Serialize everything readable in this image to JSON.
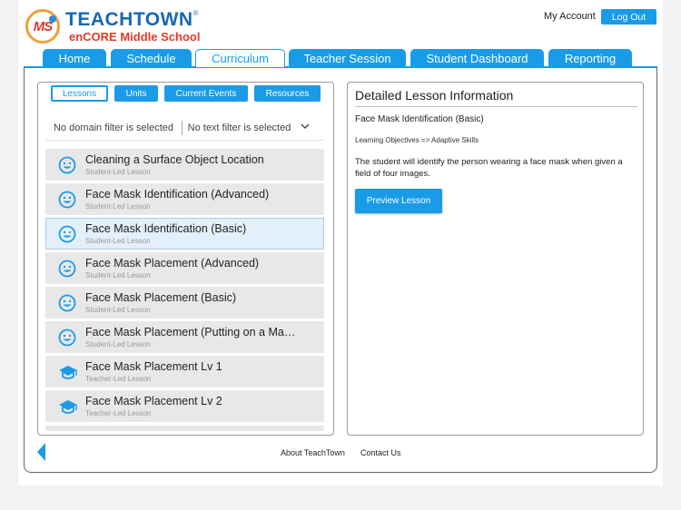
{
  "header": {
    "logo_badge": "MS",
    "brand_name": "TEACHTOWN",
    "brand_reg": "®",
    "school": "enCORE Middle School",
    "my_account": "My Account",
    "logout": "Log Out"
  },
  "tabs": [
    {
      "label": "Home"
    },
    {
      "label": "Schedule"
    },
    {
      "label": "Curriculum",
      "active": true
    },
    {
      "label": "Teacher Session"
    },
    {
      "label": "Student Dashboard"
    },
    {
      "label": "Reporting"
    }
  ],
  "segments": [
    {
      "label": "Lessons",
      "active": true
    },
    {
      "label": "Units"
    },
    {
      "label": "Current Events"
    },
    {
      "label": "Resources"
    }
  ],
  "filters": {
    "domain": "No domain filter is selected",
    "text": "No text filter is selected"
  },
  "lessons": [
    {
      "title": "Cleaning a Surface Object Location",
      "type": "Student-Led Lesson",
      "icon": "smiley-icon"
    },
    {
      "title": "Face Mask Identification (Advanced)",
      "type": "Student-Led Lesson",
      "icon": "smiley-icon"
    },
    {
      "title": "Face Mask Identification (Basic)",
      "type": "Student-Led Lesson",
      "icon": "smiley-icon",
      "selected": true
    },
    {
      "title": "Face Mask Placement (Advanced)",
      "type": "Student-Led Lesson",
      "icon": "smiley-icon"
    },
    {
      "title": "Face Mask Placement (Basic)",
      "type": "Student-Led Lesson",
      "icon": "smiley-icon"
    },
    {
      "title": "Face Mask Placement (Putting on a Ma…",
      "type": "Student-Led Lesson",
      "icon": "smiley-icon"
    },
    {
      "title": "Face Mask Placement Lv 1",
      "type": "Teacher-Led Lesson",
      "icon": "graduation-cap-icon"
    },
    {
      "title": "Face Mask Placement Lv 2",
      "type": "Teacher-Led Lesson",
      "icon": "graduation-cap-icon"
    }
  ],
  "detail": {
    "heading": "Detailed Lesson Information",
    "lesson_name": "Face Mask Identification (Basic)",
    "objectives": "Learning Objectives => Adaptive Skills",
    "description": "The student will identify the person wearing a face mask when given a field of four images.",
    "preview_button": "Preview Lesson"
  },
  "footer": {
    "about": "About TeachTown",
    "contact": "Contact Us"
  },
  "colors": {
    "accent": "#1a9be8",
    "brand_blue": "#1769b3",
    "brand_red": "#e03a2a"
  }
}
